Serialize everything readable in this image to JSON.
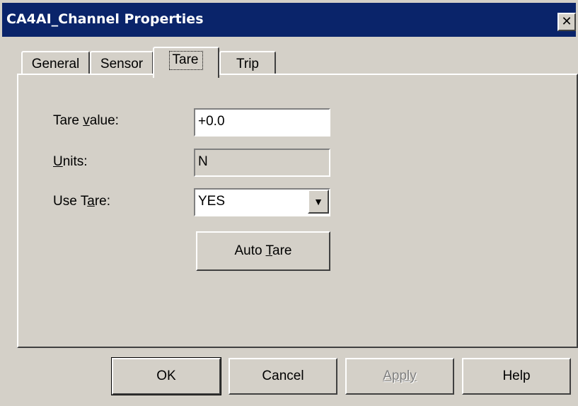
{
  "window": {
    "title": "CA4AI_Channel Properties",
    "close_glyph": "✕"
  },
  "tabs": [
    {
      "label": "General",
      "active": false
    },
    {
      "label": "Sensor",
      "active": false
    },
    {
      "label": "Tare",
      "active": true
    },
    {
      "label": "Trip",
      "active": false
    }
  ],
  "form": {
    "tare_value": {
      "label_pre": "Tare ",
      "label_key": "v",
      "label_post": "alue:",
      "value": "+0.0"
    },
    "units": {
      "label_key": "U",
      "label_post": "nits:",
      "value": "N"
    },
    "use_tare": {
      "label_pre": "Use T",
      "label_key": "a",
      "label_post": "re:",
      "value": "YES",
      "arrow_glyph": "▼"
    },
    "auto_tare": {
      "label_pre": "Auto ",
      "label_key": "T",
      "label_post": "are"
    }
  },
  "buttons": {
    "ok": "OK",
    "cancel": "Cancel",
    "apply": "Apply",
    "help": "Help"
  }
}
